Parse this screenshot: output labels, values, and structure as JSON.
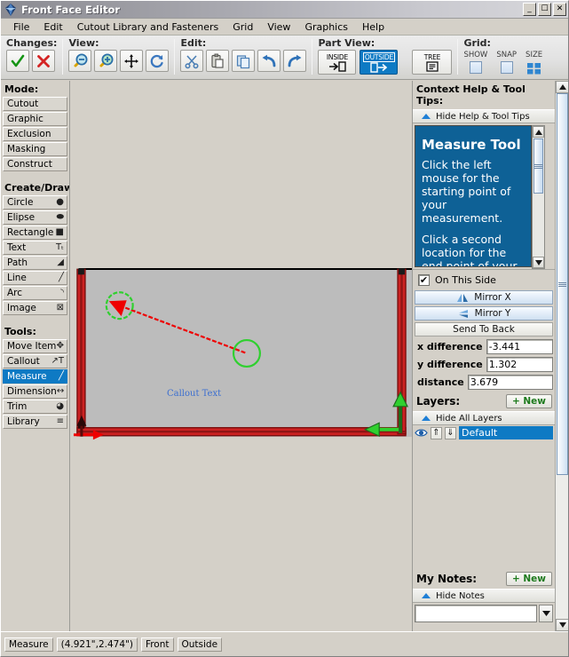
{
  "window": {
    "title": "Front Face Editor",
    "minimize_label": "_",
    "maximize_label": "☐",
    "close_label": "✕"
  },
  "menubar": {
    "items": [
      {
        "label": "File"
      },
      {
        "label": "Edit"
      },
      {
        "label": "Cutout Library and Fasteners"
      },
      {
        "label": "Grid"
      },
      {
        "label": "View"
      },
      {
        "label": "Graphics"
      },
      {
        "label": "Help"
      }
    ]
  },
  "toolbar": {
    "changes": {
      "label": "Changes:",
      "accept": "✓",
      "reject": "✕"
    },
    "view": {
      "label": "View:",
      "zoom_out": "zoom-out-icon",
      "zoom_in": "zoom-in-icon",
      "pan": "pan-icon",
      "refresh": "refresh-icon"
    },
    "edit": {
      "label": "Edit:",
      "cut": "scissors-icon",
      "paste": "clipboard-icon",
      "copy": "copy-icon",
      "undo": "undo-icon",
      "redo": "redo-icon"
    },
    "part_view": {
      "label": "Part View:",
      "inside": "INSIDE",
      "outside": "OUTSIDE",
      "tree": "TREE",
      "selected": "OUTSIDE"
    },
    "grid": {
      "label": "Grid:",
      "show": "SHOW",
      "snap": "SNAP",
      "size": "SIZE",
      "show_checked": false,
      "snap_checked": false
    }
  },
  "left_panel": {
    "mode": {
      "title": "Mode:",
      "items": [
        {
          "label": "Cutout",
          "icon": "",
          "selected": false
        },
        {
          "label": "Graphic",
          "icon": "",
          "selected": false
        },
        {
          "label": "Exclusion",
          "icon": "",
          "selected": false
        },
        {
          "label": "Masking",
          "icon": "",
          "selected": false
        },
        {
          "label": "Construct",
          "icon": "",
          "selected": false
        }
      ]
    },
    "create_draw": {
      "title": "Create/Draw:",
      "items": [
        {
          "label": "Circle",
          "icon": "●",
          "selected": false
        },
        {
          "label": "Elipse",
          "icon": "⬬",
          "selected": false
        },
        {
          "label": "Rectangle",
          "icon": "■",
          "selected": false
        },
        {
          "label": "Text",
          "icon": "Tₜ",
          "selected": false
        },
        {
          "label": "Path",
          "icon": "◢",
          "selected": false
        },
        {
          "label": "Line",
          "icon": "╱",
          "selected": false
        },
        {
          "label": "Arc",
          "icon": "◝",
          "selected": false
        },
        {
          "label": "Image",
          "icon": "⊠",
          "selected": false
        }
      ]
    },
    "tools": {
      "title": "Tools:",
      "items": [
        {
          "label": "Move Item",
          "icon": "✥",
          "selected": false
        },
        {
          "label": "Callout",
          "icon": "↗T",
          "selected": false
        },
        {
          "label": "Measure",
          "icon": "╱",
          "selected": true
        },
        {
          "label": "Dimension",
          "icon": "↔",
          "selected": false
        },
        {
          "label": "Trim",
          "icon": "◕",
          "selected": false
        },
        {
          "label": "Library",
          "icon": "≡",
          "selected": false
        }
      ]
    }
  },
  "canvas": {
    "callout_label": "Callout Text",
    "part_fill": "#bcbcbc",
    "edge_color": "#cc2222",
    "measure_color": "#ee0000",
    "handle_color": "#2fd02f",
    "arrow_left_color": "#ee0000",
    "arrow_right_color": "#2fd02f"
  },
  "right_panel": {
    "help_section": {
      "title": "Context Help & Tool Tips:",
      "toggle_label": "Hide Help & Tool Tips",
      "tip_title": "Measure Tool",
      "tip_paragraphs": [
        "Click the left mouse for the starting point of your measurement.",
        "Click a second location for the end point of your"
      ]
    },
    "options": {
      "on_this_side_label": "On This Side",
      "on_this_side_checked": true,
      "check_glyph": "✔",
      "mirror_x": "Mirror X",
      "mirror_y": "Mirror Y",
      "send_to_back": "Send To Back"
    },
    "measurements": [
      {
        "label": "x difference",
        "value": "-3.441"
      },
      {
        "label": "y difference",
        "value": "1.302"
      },
      {
        "label": "distance",
        "value": "3.679"
      }
    ],
    "layers": {
      "title": "Layers:",
      "new_label": "+ New",
      "toggle_label": "Hide All Layers",
      "rows": [
        {
          "name": "Default",
          "eye": "◉",
          "up": "⇑",
          "down": "⇓",
          "selected": true
        }
      ]
    },
    "notes": {
      "title": "My Notes:",
      "new_label": "+ New",
      "toggle_label": "Hide Notes",
      "value": "",
      "placeholder": "",
      "dropdown_glyph": "▼"
    }
  },
  "statusbar": {
    "tool": "Measure",
    "coordinates": "(4.921\",2.474\")",
    "face": "Front",
    "side": "Outside"
  }
}
